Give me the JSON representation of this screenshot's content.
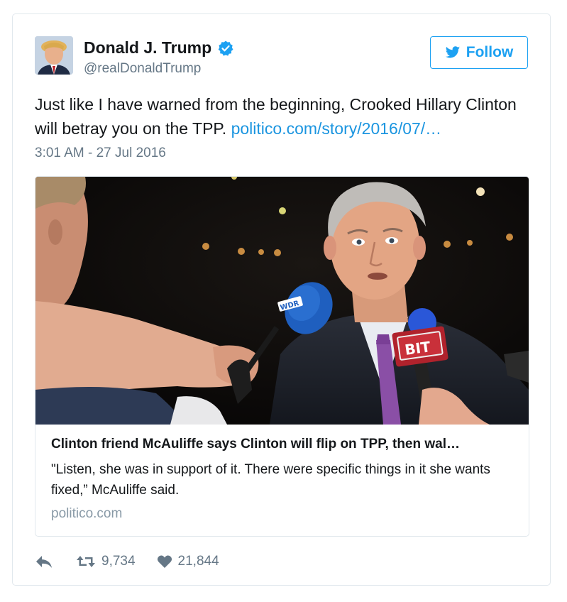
{
  "author": {
    "name": "Donald J. Trump",
    "handle": "@realDonaldTrump",
    "verified_color": "#1da1f2"
  },
  "follow_button": {
    "label": "Follow",
    "icon": "twitter-bird-icon"
  },
  "tweet": {
    "text": "Just like I have warned from the beginning, Crooked Hillary Clinton will betray you on the TPP.",
    "link_text": "politico.com/story/2016/07/…",
    "timestamp": "3:01 AM - 27 Jul 2016"
  },
  "card": {
    "image_mic_left_label": "WDR",
    "image_mic_right_label": "BIT",
    "title": "Clinton friend McAuliffe says Clinton will flip on TPP, then wal…",
    "description": "\"Listen, she was in support of it. There were specific things in it she wants fixed,” McAuliffe said.",
    "domain": "politico.com"
  },
  "actions": {
    "reply_icon": "reply-icon",
    "retweet_icon": "retweet-icon",
    "retweet_count": "9,734",
    "like_icon": "heart-icon",
    "like_count": "21,844"
  },
  "colors": {
    "link": "#1b95e0",
    "accent": "#1da1f2",
    "secondary_text": "#657786",
    "border": "#e1e8ed"
  }
}
